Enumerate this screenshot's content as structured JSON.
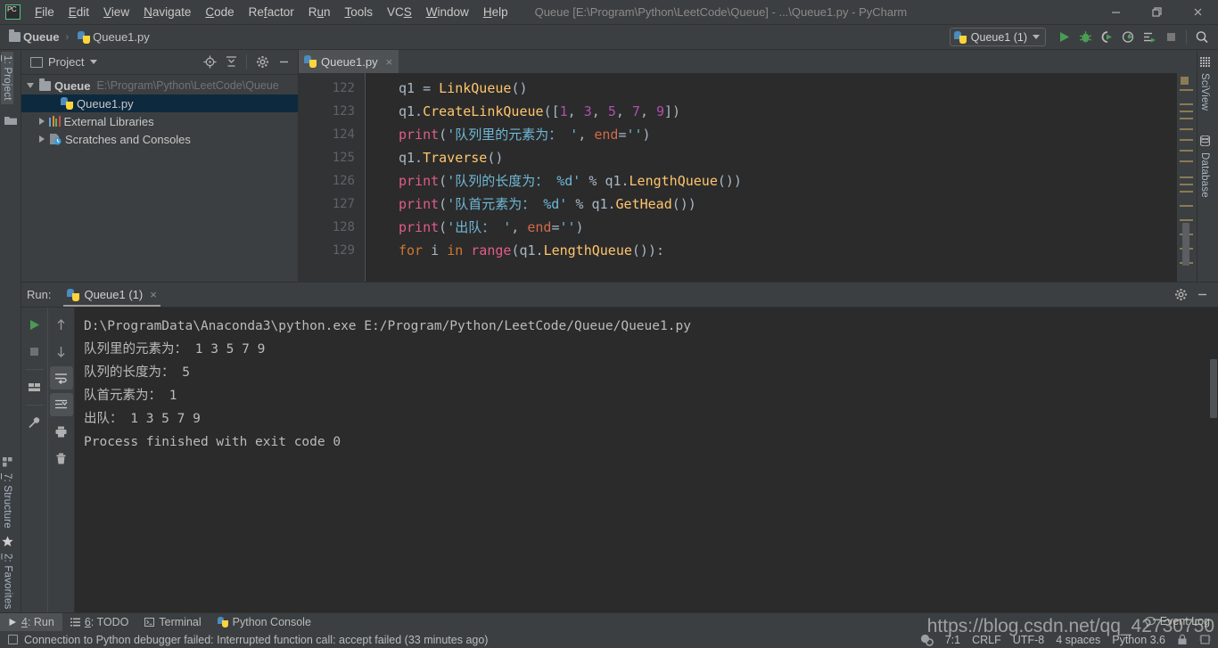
{
  "window": {
    "app_name": "PyCharm",
    "title": "Queue [E:\\Program\\Python\\LeetCode\\Queue] - ...\\Queue1.py - PyCharm",
    "logo_text": "PC",
    "controls": {
      "minimize": "minimize-icon",
      "maximize": "maximize-icon",
      "close": "close-icon"
    }
  },
  "menubar": {
    "items": [
      {
        "label": "File"
      },
      {
        "label": "Edit"
      },
      {
        "label": "View"
      },
      {
        "label": "Navigate"
      },
      {
        "label": "Code"
      },
      {
        "label": "Refactor"
      },
      {
        "label": "Run"
      },
      {
        "label": "Tools"
      },
      {
        "label": "VCS"
      },
      {
        "label": "Window"
      },
      {
        "label": "Help"
      }
    ]
  },
  "navbar": {
    "breadcrumbs": [
      {
        "label": "Queue",
        "icon": "folder-icon"
      },
      {
        "label": "Queue1.py",
        "icon": "python-file-icon"
      }
    ],
    "separator": "›",
    "run_config": {
      "label": "Queue1 (1)",
      "icon": "python-icon"
    },
    "toolbar_buttons": [
      {
        "name": "run-button",
        "icon": "run-icon"
      },
      {
        "name": "debug-button",
        "icon": "debug-icon"
      },
      {
        "name": "run-coverage-button",
        "icon": "coverage-icon"
      },
      {
        "name": "profile-button",
        "icon": "profile-icon"
      },
      {
        "name": "run-with-options-button",
        "icon": "run-list-icon"
      },
      {
        "name": "stop-button",
        "icon": "stop-icon"
      },
      {
        "name": "search-everywhere-button",
        "icon": "search-icon"
      }
    ]
  },
  "left_strip": {
    "top": [
      {
        "label": "1: Project",
        "accel": "1",
        "active": true
      }
    ],
    "bottom": [
      {
        "label": "7: Structure",
        "accel": "7"
      },
      {
        "label": "2: Favorites",
        "accel": "2"
      }
    ]
  },
  "right_strip": {
    "items": [
      {
        "label": "SciView",
        "icon": "grid-icon"
      },
      {
        "label": "Database",
        "icon": "database-icon"
      }
    ]
  },
  "project_panel": {
    "title": "Project",
    "header_buttons": [
      {
        "name": "scroll-from-source-button",
        "icon": "target-icon"
      },
      {
        "name": "collapse-all-button",
        "icon": "collapse-icon"
      },
      {
        "name": "settings-button",
        "icon": "gear-icon"
      },
      {
        "name": "hide-button",
        "icon": "minimize-icon"
      }
    ],
    "tree": [
      {
        "label": "Queue",
        "sublabel": "E:\\Program\\Python\\LeetCode\\Queue",
        "icon": "folder-icon",
        "expanded": true,
        "depth": 0,
        "bold": true,
        "selected": false
      },
      {
        "label": "Queue1.py",
        "sublabel": "",
        "icon": "python-file-icon",
        "expanded": null,
        "depth": 1,
        "bold": false,
        "selected": true
      },
      {
        "label": "External Libraries",
        "sublabel": "",
        "icon": "libraries-icon",
        "expanded": false,
        "depth": 0,
        "bold": false,
        "selected": false
      },
      {
        "label": "Scratches and Consoles",
        "sublabel": "",
        "icon": "scratches-icon",
        "expanded": false,
        "depth": 0,
        "bold": false,
        "selected": false
      }
    ]
  },
  "editor": {
    "tabs": [
      {
        "label": "Queue1.py",
        "icon": "python-file-icon",
        "active": true,
        "close": "×"
      }
    ],
    "first_line_number": 122,
    "lines": [
      {
        "num": "122",
        "tokens": [
          {
            "t": "q1 ",
            "c": "t-def"
          },
          {
            "t": "= ",
            "c": "t-def"
          },
          {
            "t": "LinkQueue",
            "c": "t-fn"
          },
          {
            "t": "()",
            "c": "t-def"
          }
        ]
      },
      {
        "num": "123",
        "tokens": [
          {
            "t": "q1.",
            "c": "t-def"
          },
          {
            "t": "CreateLinkQueue",
            "c": "t-fn"
          },
          {
            "t": "([",
            "c": "t-def"
          },
          {
            "t": "1",
            "c": "t-purple"
          },
          {
            "t": ", ",
            "c": "t-def"
          },
          {
            "t": "3",
            "c": "t-purple"
          },
          {
            "t": ", ",
            "c": "t-def"
          },
          {
            "t": "5",
            "c": "t-purple"
          },
          {
            "t": ", ",
            "c": "t-def"
          },
          {
            "t": "7",
            "c": "t-purple"
          },
          {
            "t": ", ",
            "c": "t-def"
          },
          {
            "t": "9",
            "c": "t-purple"
          },
          {
            "t": "])",
            "c": "t-def"
          }
        ]
      },
      {
        "num": "124",
        "tokens": [
          {
            "t": "print",
            "c": "t-pink"
          },
          {
            "t": "(",
            "c": "t-def"
          },
          {
            "t": "'队列里的元素为： '",
            "c": "t-lblue"
          },
          {
            "t": ", ",
            "c": "t-def"
          },
          {
            "t": "end",
            "c": "t-kwarg"
          },
          {
            "t": "=",
            "c": "t-def"
          },
          {
            "t": "''",
            "c": "t-lblue"
          },
          {
            "t": ")",
            "c": "t-def"
          }
        ]
      },
      {
        "num": "125",
        "tokens": [
          {
            "t": "q1.",
            "c": "t-def"
          },
          {
            "t": "Traverse",
            "c": "t-fn"
          },
          {
            "t": "()",
            "c": "t-def"
          }
        ]
      },
      {
        "num": "126",
        "tokens": [
          {
            "t": "print",
            "c": "t-pink"
          },
          {
            "t": "(",
            "c": "t-def"
          },
          {
            "t": "'队列的长度为： %d'",
            "c": "t-lblue"
          },
          {
            "t": " % ",
            "c": "t-def"
          },
          {
            "t": "q1.",
            "c": "t-def"
          },
          {
            "t": "LengthQueue",
            "c": "t-fn"
          },
          {
            "t": "())",
            "c": "t-def"
          }
        ]
      },
      {
        "num": "127",
        "tokens": [
          {
            "t": "print",
            "c": "t-pink"
          },
          {
            "t": "(",
            "c": "t-def"
          },
          {
            "t": "'队首元素为： %d'",
            "c": "t-lblue"
          },
          {
            "t": " % ",
            "c": "t-def"
          },
          {
            "t": "q1.",
            "c": "t-def"
          },
          {
            "t": "GetHead",
            "c": "t-fn"
          },
          {
            "t": "())",
            "c": "t-def"
          }
        ]
      },
      {
        "num": "128",
        "tokens": [
          {
            "t": "print",
            "c": "t-pink"
          },
          {
            "t": "(",
            "c": "t-def"
          },
          {
            "t": "'出队： '",
            "c": "t-lblue"
          },
          {
            "t": ", ",
            "c": "t-def"
          },
          {
            "t": "end",
            "c": "t-kwarg"
          },
          {
            "t": "=",
            "c": "t-def"
          },
          {
            "t": "''",
            "c": "t-lblue"
          },
          {
            "t": ")",
            "c": "t-def"
          }
        ]
      },
      {
        "num": "129",
        "tokens": [
          {
            "t": "for",
            "c": "t-kw"
          },
          {
            "t": " i ",
            "c": "t-def"
          },
          {
            "t": "in",
            "c": "t-kw"
          },
          {
            "t": " ",
            "c": "t-def"
          },
          {
            "t": "range",
            "c": "t-pink"
          },
          {
            "t": "(",
            "c": "t-def"
          },
          {
            "t": "q1.",
            "c": "t-def"
          },
          {
            "t": "LengthQueue",
            "c": "t-fn"
          },
          {
            "t": "()):",
            "c": "t-def"
          }
        ]
      }
    ]
  },
  "run_panel": {
    "label": "Run:",
    "tab": {
      "label": "Queue1 (1)",
      "icon": "python-icon",
      "close": "×"
    },
    "header_buttons": [
      {
        "name": "settings-button",
        "icon": "gear-icon"
      },
      {
        "name": "hide-button",
        "icon": "minimize-icon"
      }
    ],
    "tools_col1": [
      {
        "name": "rerun-button",
        "icon": "run-icon"
      },
      {
        "name": "stop-button",
        "icon": "stop-icon"
      },
      {
        "name": "layout-button",
        "icon": "layout-icon"
      },
      {
        "name": "pin-tab-button",
        "icon": "pin-icon"
      }
    ],
    "tools_col2": [
      {
        "name": "previous-occurrence-button",
        "icon": "arrow-up-icon"
      },
      {
        "name": "next-occurrence-button",
        "icon": "arrow-down-icon"
      },
      {
        "name": "soft-wrap-button",
        "icon": "soft-wrap-icon",
        "active": true
      },
      {
        "name": "scroll-to-end-button",
        "icon": "scroll-end-icon",
        "active": true
      },
      {
        "name": "print-button",
        "icon": "printer-icon"
      },
      {
        "name": "clear-all-button",
        "icon": "trash-icon"
      }
    ],
    "console_lines": [
      "D:\\ProgramData\\Anaconda3\\python.exe E:/Program/Python/LeetCode/Queue/Queue1.py",
      "队列里的元素为： 1 3 5 7 9",
      "队列的长度为： 5",
      "队首元素为： 1",
      "出队： 1 3 5 7 9",
      "Process finished with exit code 0"
    ]
  },
  "bottom_bar": {
    "items": [
      {
        "label": "4: Run",
        "accel": "4",
        "icon": "run-icon",
        "active": true
      },
      {
        "label": "6: TODO",
        "accel": "6",
        "icon": "todo-icon",
        "active": false
      },
      {
        "label": "Terminal",
        "accel": "",
        "icon": "terminal-icon",
        "active": false
      },
      {
        "label": "Python Console",
        "accel": "",
        "icon": "python-icon",
        "active": false
      }
    ]
  },
  "statusbar": {
    "message": "Connection to Python debugger failed: Interrupted function call: accept failed (33 minutes ago)",
    "message_icon": "balloon-icon",
    "caret_position": "7:1",
    "line_separator": "CRLF",
    "encoding": "UTF-8",
    "indent": "4 spaces",
    "interpreter": "Python 3.6",
    "event_log": "Event Log"
  },
  "watermark": {
    "text": "https://blog.csdn.net/qq_42730750"
  },
  "colors": {
    "window_bg": "#3c3f41",
    "editor_bg": "#2b2b2b",
    "gutter_bg": "#313335",
    "selection_blue": "#0d293e",
    "accent_green": "#499c54",
    "tab_active": "#4e5254",
    "text": "#bbbbbb"
  }
}
